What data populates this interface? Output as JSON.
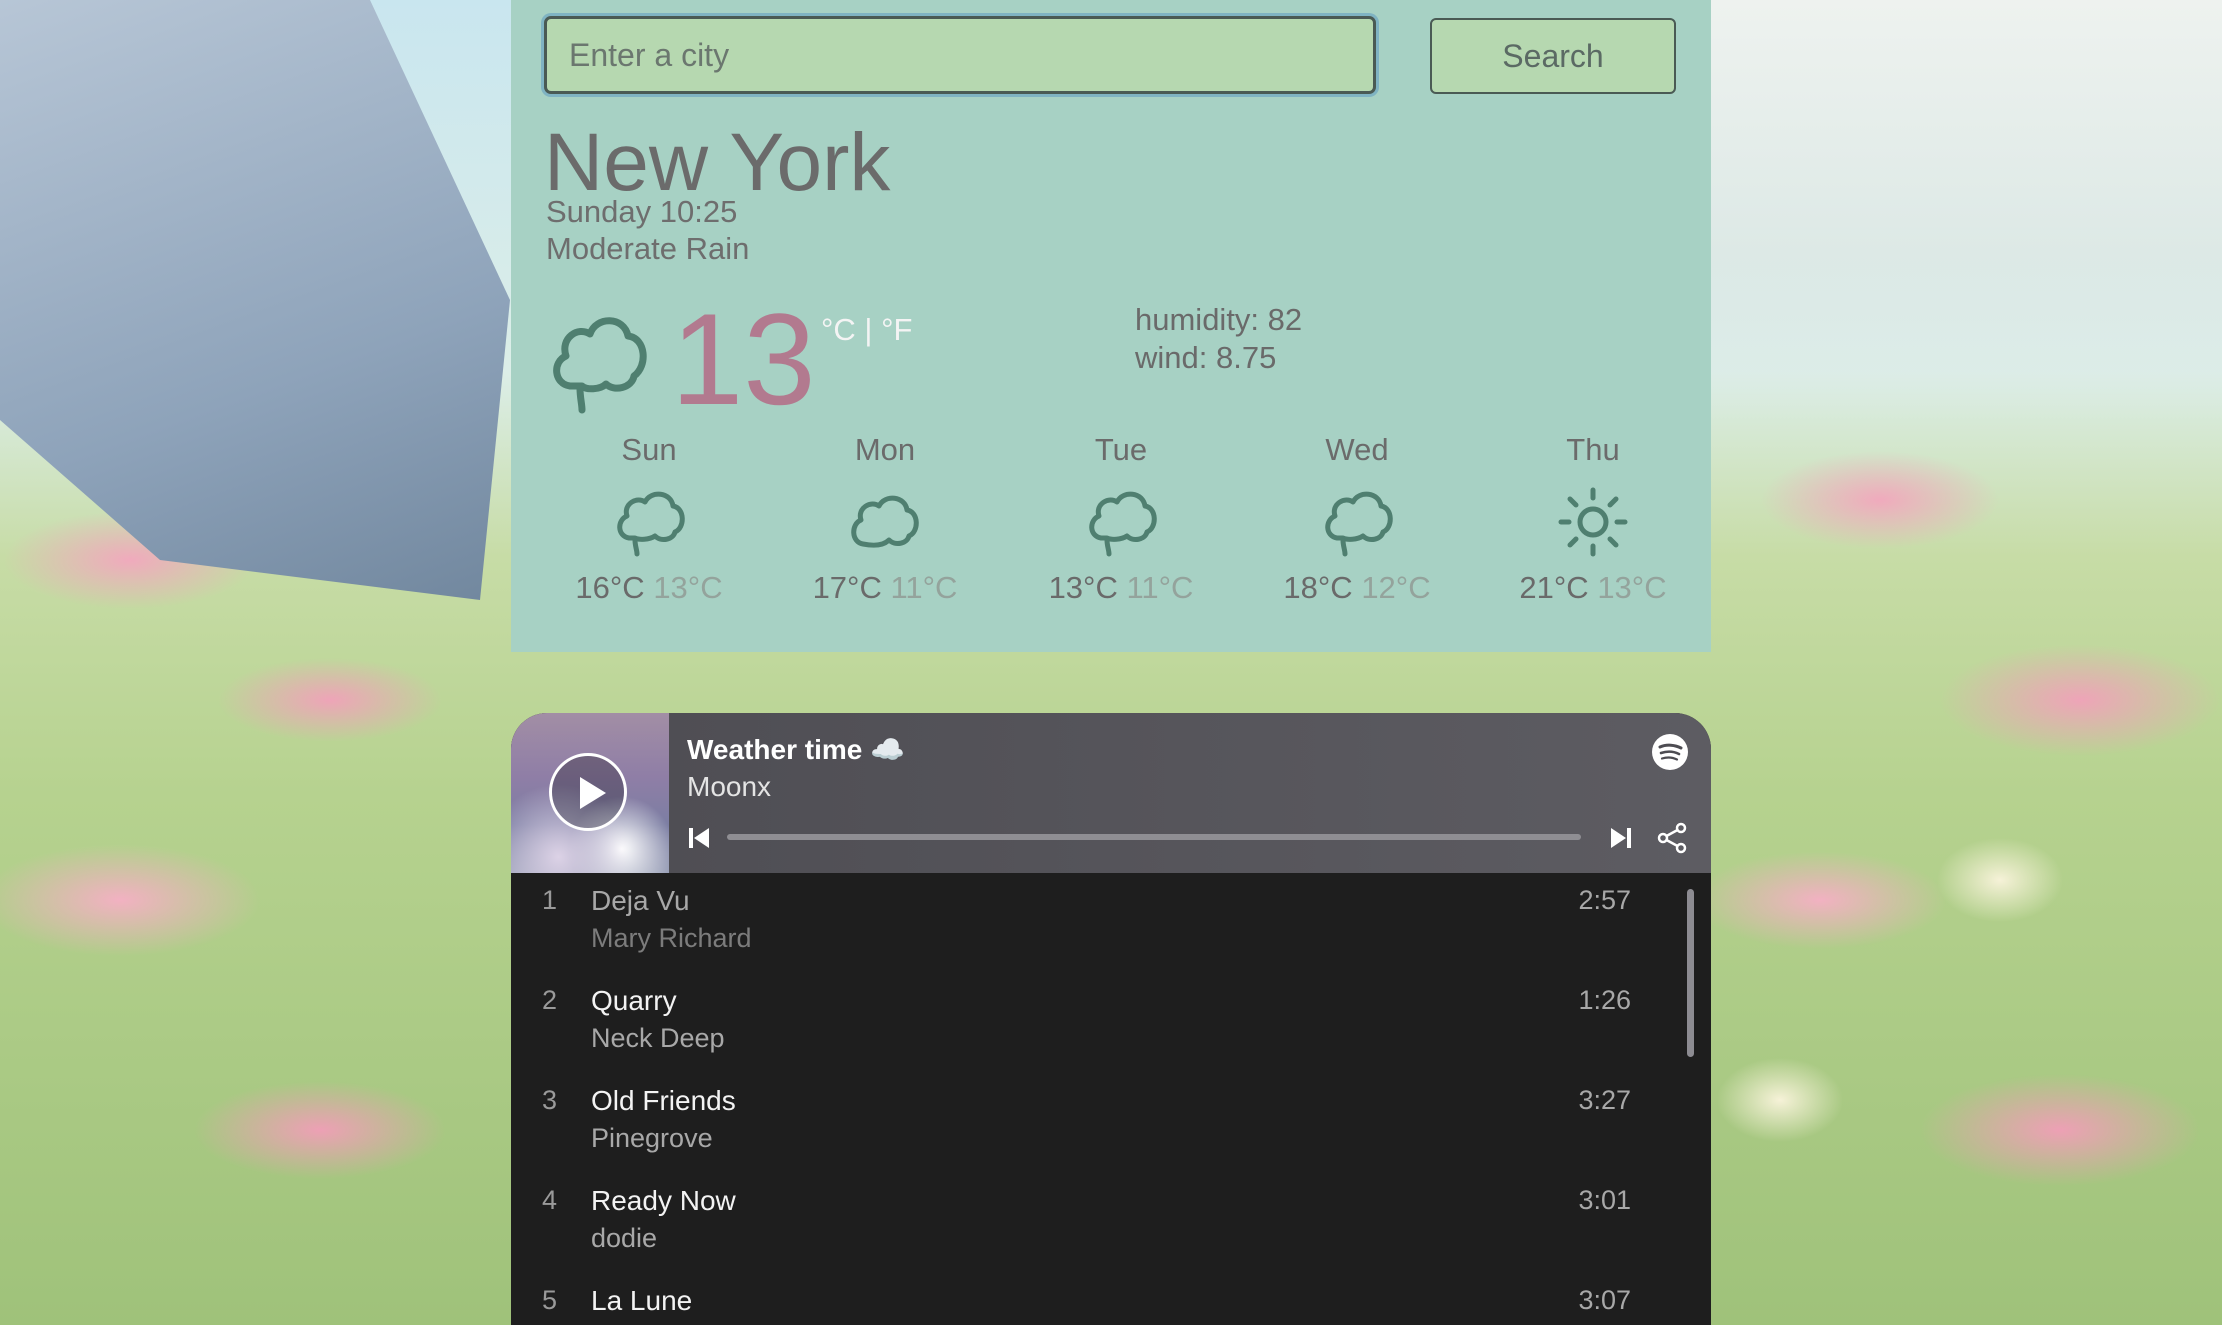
{
  "search": {
    "placeholder": "Enter a city",
    "button_label": "Search"
  },
  "weather": {
    "city": "New York",
    "date": "Sunday 10:25",
    "condition": "Moderate Rain",
    "temperature": "13",
    "units": "°C | °F",
    "humidity": "humidity: 82",
    "wind": "wind: 8.75",
    "icon": "cloud-rain-icon",
    "forecast": [
      {
        "day": "Sun",
        "icon": "cloud-icon",
        "high": "16°C",
        "low": "13°C"
      },
      {
        "day": "Mon",
        "icon": "cloud-icon",
        "high": "17°C",
        "low": "11°C"
      },
      {
        "day": "Tue",
        "icon": "cloud-icon",
        "high": "13°C",
        "low": "11°C"
      },
      {
        "day": "Wed",
        "icon": "cloud-icon",
        "high": "18°C",
        "low": "12°C"
      },
      {
        "day": "Thu",
        "icon": "sun-icon",
        "high": "21°C",
        "low": "13°C"
      }
    ]
  },
  "player": {
    "title": "Weather time ☁️",
    "artist": "Moonx",
    "progress": 0.0,
    "tracks": [
      {
        "num": "1",
        "name": "Deja Vu",
        "artist": "Mary Richard",
        "duration": "2:57"
      },
      {
        "num": "2",
        "name": "Quarry",
        "artist": "Neck Deep",
        "duration": "1:26"
      },
      {
        "num": "3",
        "name": "Old Friends",
        "artist": "Pinegrove",
        "duration": "3:27"
      },
      {
        "num": "4",
        "name": "Ready Now",
        "artist": "dodie",
        "duration": "3:01"
      },
      {
        "num": "5",
        "name": "La Lune",
        "artist": "",
        "duration": "3:07"
      }
    ]
  },
  "colors": {
    "weather_bg": "#a7d1c4",
    "accent_temp": "#b27a8f",
    "icon_color": "#4f7f70",
    "player_bg": "#1e1e1e"
  }
}
